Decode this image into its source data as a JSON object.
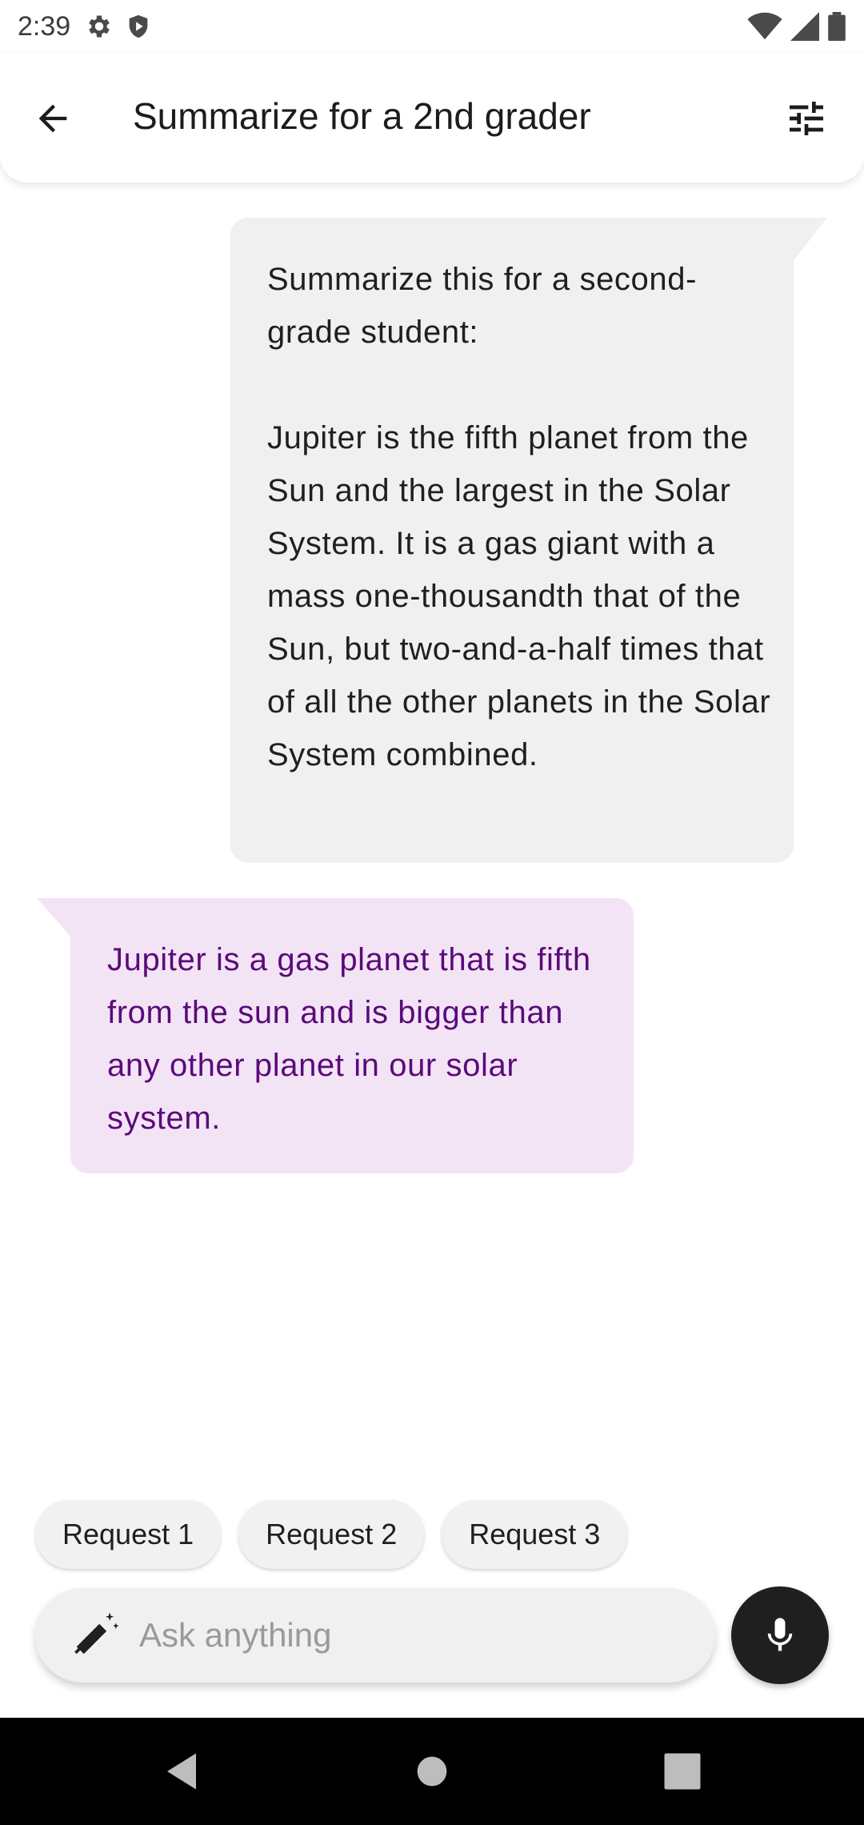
{
  "status_bar": {
    "time": "2:39",
    "icons": [
      "settings-icon",
      "shield-icon",
      "wifi-icon",
      "signal-icon",
      "battery-icon"
    ]
  },
  "app_bar": {
    "title": "Summarize for a 2nd grader",
    "back_icon": "arrow-back-icon",
    "tune_icon": "tune-icon"
  },
  "chat": {
    "messages": [
      {
        "role": "user",
        "text": "Summarize this for a second-grade student:\n\nJupiter is the fifth planet from the Sun and the largest in the Solar System. It is a gas giant with a mass one-thousandth that of the Sun, but two-and-a-half times that of all the other planets in the Solar System combined."
      },
      {
        "role": "model",
        "text": "Jupiter is a gas planet that is fifth from the sun and is bigger than any other planet in our solar system."
      }
    ]
  },
  "suggestions": [
    {
      "label": "Request 1"
    },
    {
      "label": "Request 2"
    },
    {
      "label": "Request 3"
    }
  ],
  "input": {
    "value": "",
    "placeholder": "Ask anything",
    "icon": "magic-pen-icon"
  },
  "mic": {
    "icon": "mic-icon"
  },
  "colors": {
    "user_bubble": "#f0f0f0",
    "model_bubble": "#f3e4f5",
    "model_text": "#5a0a7a",
    "mic_button": "#1f1f1f"
  }
}
